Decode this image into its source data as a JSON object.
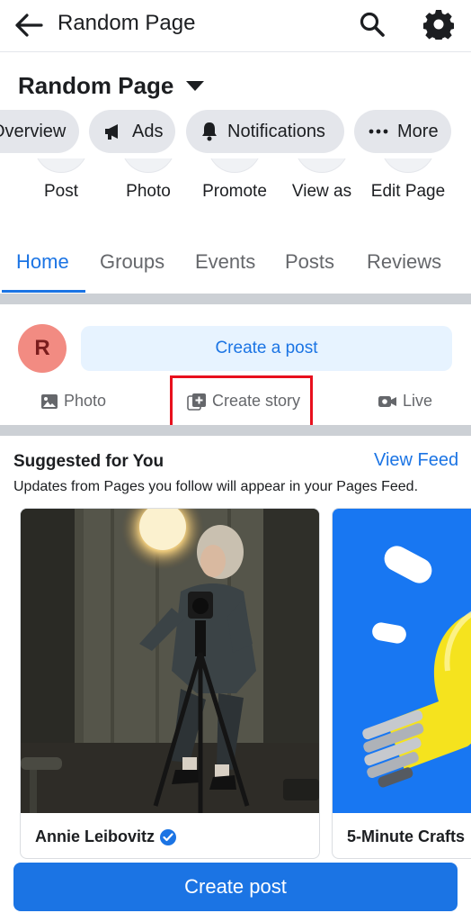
{
  "appbar": {
    "title": "Random Page"
  },
  "page": {
    "name": "Random Page"
  },
  "chips": [
    {
      "label": "Overview",
      "icon": "overview-icon"
    },
    {
      "label": "Ads",
      "icon": "megaphone-icon"
    },
    {
      "label": "Notifications",
      "icon": "bell-icon"
    },
    {
      "label": "More",
      "icon": "more-icon"
    }
  ],
  "actions": [
    {
      "label": "Post"
    },
    {
      "label": "Photo"
    },
    {
      "label": "Promote"
    },
    {
      "label": "View as"
    },
    {
      "label": "Edit Page"
    }
  ],
  "tabs": [
    {
      "label": "Home",
      "active": true
    },
    {
      "label": "Groups"
    },
    {
      "label": "Events"
    },
    {
      "label": "Posts"
    },
    {
      "label": "Reviews"
    }
  ],
  "composer": {
    "avatar_letter": "R",
    "create_post_label": "Create a post",
    "options": [
      {
        "label": "Photo",
        "icon": "photo-icon"
      },
      {
        "label": "Create story",
        "icon": "create-story-icon"
      },
      {
        "label": "Live",
        "icon": "live-video-icon"
      }
    ]
  },
  "suggested": {
    "title": "Suggested for You",
    "view_feed": "View Feed",
    "subtitle": "Updates from Pages you follow will appear in your Pages Feed.",
    "cards": [
      {
        "name": "Annie Leibovitz",
        "verified": true
      },
      {
        "name": "5-Minute Crafts"
      }
    ]
  },
  "bottom_button": {
    "label": "Create post"
  },
  "colors": {
    "accent": "#1b74e4",
    "highlight": "#e8101d",
    "avatar": "#f28b82"
  }
}
